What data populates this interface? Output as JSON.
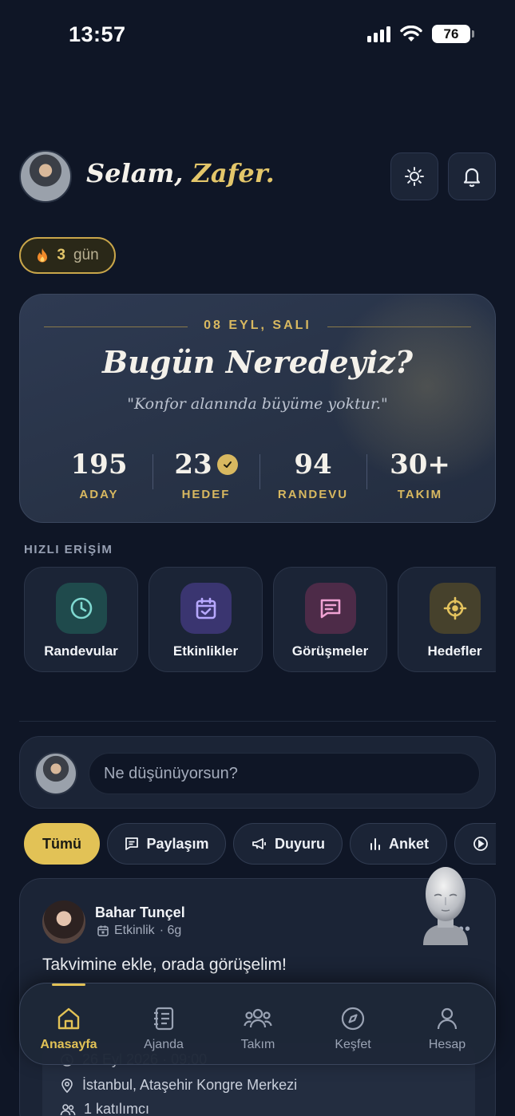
{
  "status_bar": {
    "time": "13:57",
    "battery": "76"
  },
  "header": {
    "greeting": "Selam,",
    "name": "Zafer."
  },
  "streak": {
    "count": "3",
    "unit": "gün"
  },
  "hero": {
    "date": "08 EYL, SALI",
    "title": "Bugün Neredeyiz?",
    "quote": "\"Konfor alanında büyüme yoktur.\"",
    "stats": [
      {
        "value": "195",
        "label": "ADAY"
      },
      {
        "value": "23",
        "label": "HEDEF"
      },
      {
        "value": "94",
        "label": "RANDEVU"
      },
      {
        "value": "30+",
        "label": "TAKIM"
      }
    ]
  },
  "quick_access": {
    "title": "HIZLI ERİŞİM",
    "items": [
      {
        "label": "Randevular",
        "icon": "clock-icon"
      },
      {
        "label": "Etkinlikler",
        "icon": "calendar-check-icon"
      },
      {
        "label": "Görüşmeler",
        "icon": "message-icon"
      },
      {
        "label": "Hedefler",
        "icon": "target-icon"
      }
    ]
  },
  "composer": {
    "placeholder": "Ne düşünüyorsun?"
  },
  "filters": [
    {
      "label": "Tümü",
      "icon": ""
    },
    {
      "label": "Paylaşım",
      "icon": "chat-icon"
    },
    {
      "label": "Duyuru",
      "icon": "megaphone-icon"
    },
    {
      "label": "Anket",
      "icon": "bar-chart-icon"
    },
    {
      "label": "",
      "icon": "play-icon"
    }
  ],
  "post": {
    "author": "Bahar Tunçel",
    "type": "Etkinlik",
    "age": "· 6g",
    "text": "Takvimine ekle, orada görüşelim!",
    "event_date": "26 Eyl 2026 · 09:00",
    "location": "İstanbul, Ataşehir Kongre Merkezi",
    "participants": "1 katılımcı",
    "more": "•••"
  },
  "tabbar": [
    {
      "label": "Anasayfa",
      "icon": "home-icon",
      "active": true
    },
    {
      "label": "Ajanda",
      "icon": "notebook-icon",
      "active": false
    },
    {
      "label": "Takım",
      "icon": "team-icon",
      "active": false
    },
    {
      "label": "Keşfet",
      "icon": "compass-icon",
      "active": false
    },
    {
      "label": "Hesap",
      "icon": "user-icon",
      "active": false
    }
  ],
  "colors": {
    "background": "#0f1626",
    "accent": "#e2c256",
    "card": "#1b2436"
  }
}
